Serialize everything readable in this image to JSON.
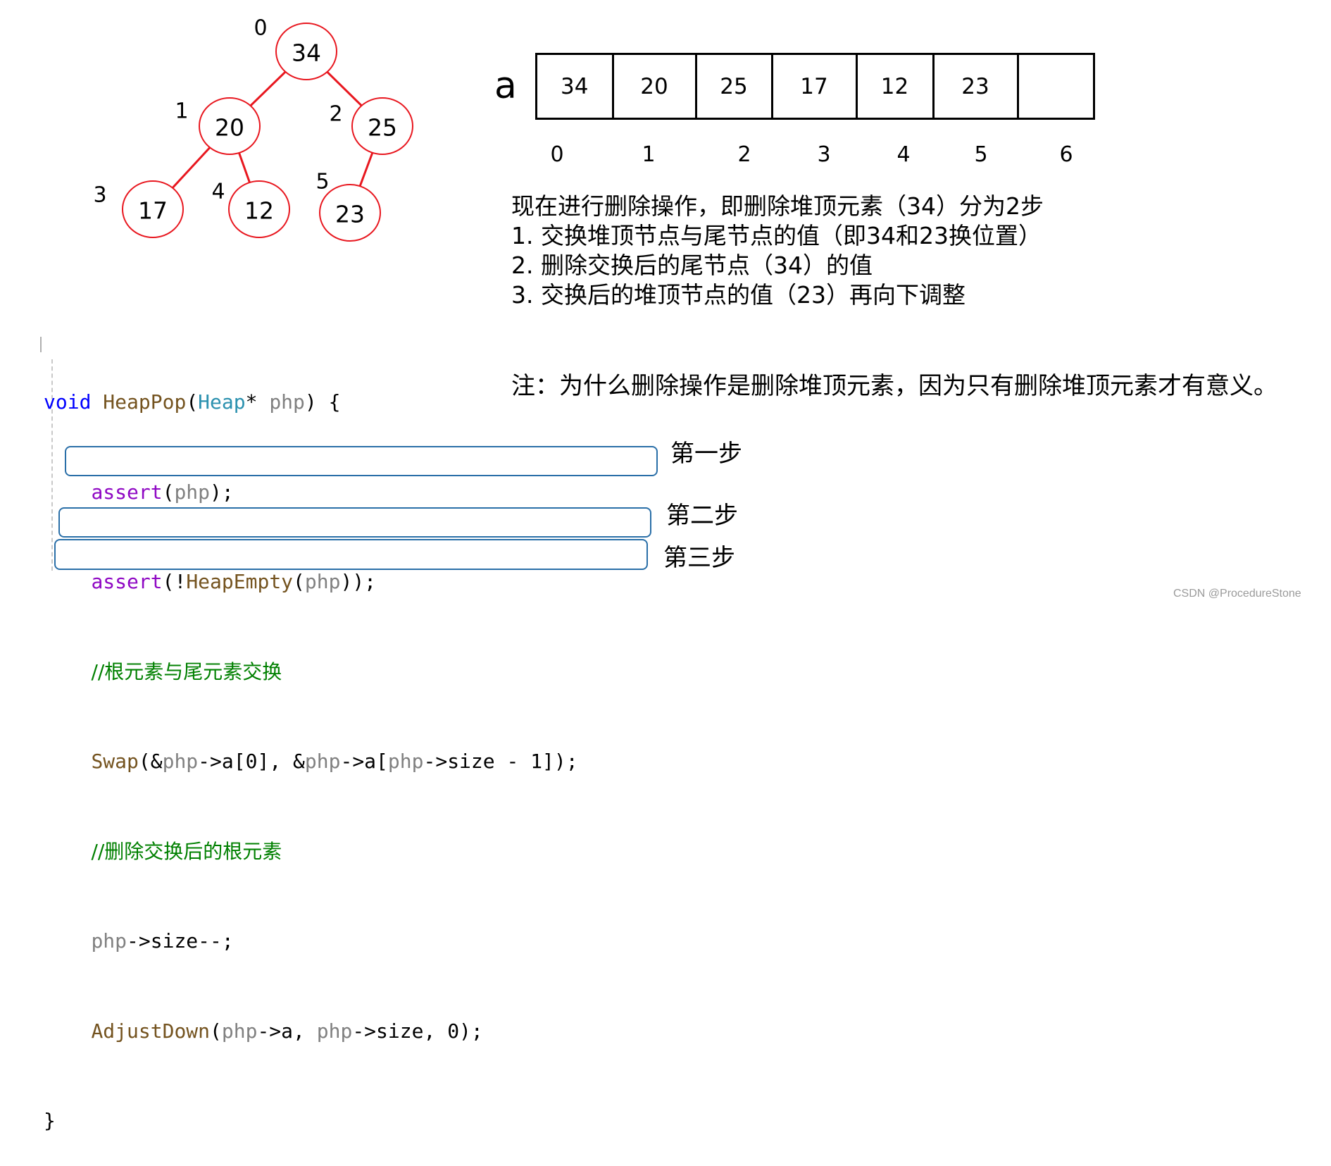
{
  "tree": {
    "stroke_color": "#e8171f",
    "nodes": [
      {
        "index": "0",
        "value": "34"
      },
      {
        "index": "1",
        "value": "20"
      },
      {
        "index": "2",
        "value": "25"
      },
      {
        "index": "3",
        "value": "17"
      },
      {
        "index": "4",
        "value": "12"
      },
      {
        "index": "5",
        "value": "23"
      }
    ],
    "edges": [
      [
        0,
        1
      ],
      [
        0,
        2
      ],
      [
        1,
        3
      ],
      [
        1,
        4
      ],
      [
        2,
        5
      ]
    ]
  },
  "array": {
    "name": "a",
    "cells": [
      "34",
      "20",
      "25",
      "17",
      "12",
      "23",
      ""
    ],
    "indices": [
      "0",
      "1",
      "2",
      "3",
      "4",
      "5",
      "6"
    ]
  },
  "description": {
    "lines": [
      "现在进行删除操作，即删除堆顶元素（34）分为2步",
      "1. 交换堆顶节点与尾节点的值（即34和23换位置）",
      "2. 删除交换后的尾节点（34）的值",
      "3. 交换后的堆顶节点的值（23）再向下调整"
    ],
    "note": "注：为什么删除操作是删除堆顶元素，因为只有删除堆顶元素才有意义。"
  },
  "code": {
    "signature": {
      "kw": "void",
      "fn": "HeapPop",
      "open": "(",
      "type": "Heap",
      "star": "*",
      "param": "php",
      "close": ") {"
    },
    "assert1": {
      "fn": "assert",
      "open": "(",
      "arg": "php",
      "close": ");"
    },
    "assert2": {
      "fn": "assert",
      "open": "(!",
      "inner_fn": "HeapEmpty",
      "open2": "(",
      "arg": "php",
      "close": "));"
    },
    "comment1": "//根元素与尾元素交换",
    "swap": {
      "fn": "Swap",
      "p1": "(&",
      "a1": "php",
      "p2": "->a[0], &",
      "a2": "php",
      "p3": "->a[",
      "a3": "php",
      "p4": "->size - 1]);"
    },
    "comment2": "//删除交换后的根元素",
    "dec": {
      "a": "php",
      "rest": "->size--;"
    },
    "adjust": {
      "fn": "AdjustDown",
      "p1": "(",
      "a1": "php",
      "p2": "->a, ",
      "a2": "php",
      "p3": "->size, 0);"
    },
    "closing": "}"
  },
  "steps": [
    "第一步",
    "第二步",
    "第三步"
  ],
  "highlight_color": "#2a6fa8",
  "watermark": "CSDN @ProcedureStone"
}
